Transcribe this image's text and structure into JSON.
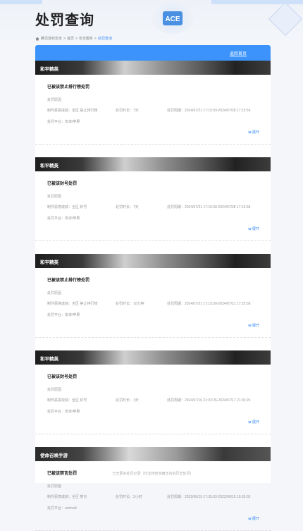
{
  "header": {
    "title": "处罚查询",
    "logo_text": "ACE"
  },
  "breadcrumb": {
    "items": [
      "腾讯游戏安全",
      "首页",
      "安全服务"
    ],
    "separator": ">",
    "current": "处罚查询"
  },
  "panel": {
    "back_label": "返回首页"
  },
  "labels": {
    "expand": "展开"
  },
  "records": [
    {
      "game": "和平精英",
      "title": "已被该禁止排行榜处罚",
      "reason": "处罚原因",
      "reason_detail": "制作恶意成绩：全区 禁止排行榜",
      "duration": "处罚时长：7天",
      "period": "处罚周期：2024/07/21 17:15:59-2024/07/28 17:15:59",
      "platform": "处罚平台：安卓/苹果"
    },
    {
      "game": "和平精英",
      "title": "已被该封号处罚",
      "reason": "处罚原因",
      "reason_detail": "制作恶意成绩：全区 封号",
      "duration": "处罚时长：7天",
      "period": "处罚周期：2024/07/21 17:15:58-2024/07/28 17:15:58",
      "platform": "处罚平台：安卓/苹果"
    },
    {
      "game": "和平精英",
      "title": "已被该禁止排行榜处罚",
      "reason": "处罚原因",
      "reason_detail": "制作恶意成绩：全区 禁止排行榜",
      "duration": "处罚时长：10分钟",
      "period": "处罚周期：2024/07/21 17:15:58-2024/07/21 17:25:58",
      "platform": "处罚平台：安卓/苹果"
    },
    {
      "game": "和平精英",
      "title": "已被该封号处罚",
      "reason": "处罚原因",
      "reason_detail": "制作恶意成绩：全区 封号",
      "duration": "处罚时长：1天",
      "period": "处罚周期：2024/07/16 21:03:26-2024/07/17 21:03:26",
      "platform": "处罚平台：安卓/苹果"
    },
    {
      "game": "使命召唤手游",
      "title": "已被该禁言处罚",
      "reason": "处罚原因",
      "reason_detail": "制作恶意成绩：全区 禁言",
      "duration": "处罚时长：2小时",
      "period": "处罚周期：2022/06/19 17:35:03-2022/06/19 19:35:03",
      "platform": "处罚平台：android"
    }
  ],
  "footer": {
    "note": "已无更多处罚记录（仅支持查询两年内的历史处罚）"
  },
  "colors": {
    "accent": "#3b93fb",
    "link": "#3b8cf5"
  }
}
